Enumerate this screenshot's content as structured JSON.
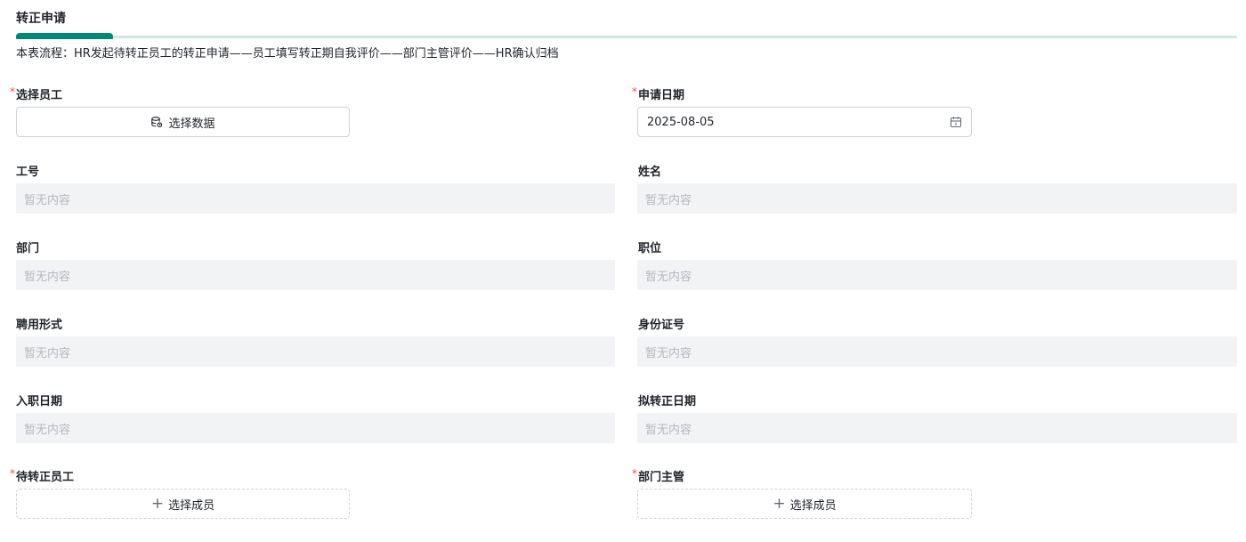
{
  "section": {
    "title": "转正申请",
    "description": "本表流程：HR发起待转正员工的转正申请——员工填写转正期自我评价——部门主管评价——HR确认归档"
  },
  "required_mark": "*",
  "fields": {
    "select_employee": {
      "label": "选择员工",
      "button_label": "选择数据",
      "icon": "database-icon"
    },
    "apply_date": {
      "label": "申请日期",
      "value": "2025-08-05",
      "icon": "calendar-icon"
    },
    "employee_no": {
      "label": "工号",
      "value": "暂无内容"
    },
    "name": {
      "label": "姓名",
      "value": "暂无内容"
    },
    "department": {
      "label": "部门",
      "value": "暂无内容"
    },
    "position": {
      "label": "职位",
      "value": "暂无内容"
    },
    "employment_type": {
      "label": "聘用形式",
      "value": "暂无内容"
    },
    "id_number": {
      "label": "身份证号",
      "value": "暂无内容"
    },
    "hire_date": {
      "label": "入职日期",
      "value": "暂无内容"
    },
    "planned_regular_date": {
      "label": "拟转正日期",
      "value": "暂无内容"
    },
    "pending_employee": {
      "label": "待转正员工",
      "button_label": "选择成员",
      "icon": "plus-icon"
    },
    "dept_manager": {
      "label": "部门主管",
      "button_label": "选择成员",
      "icon": "plus-icon"
    }
  },
  "colors": {
    "accent": "#00897b",
    "accent_track": "#cfe8e1",
    "required": "#f54a45",
    "readonly_bg": "#f2f3f5",
    "placeholder_text": "#b4b8bf"
  }
}
